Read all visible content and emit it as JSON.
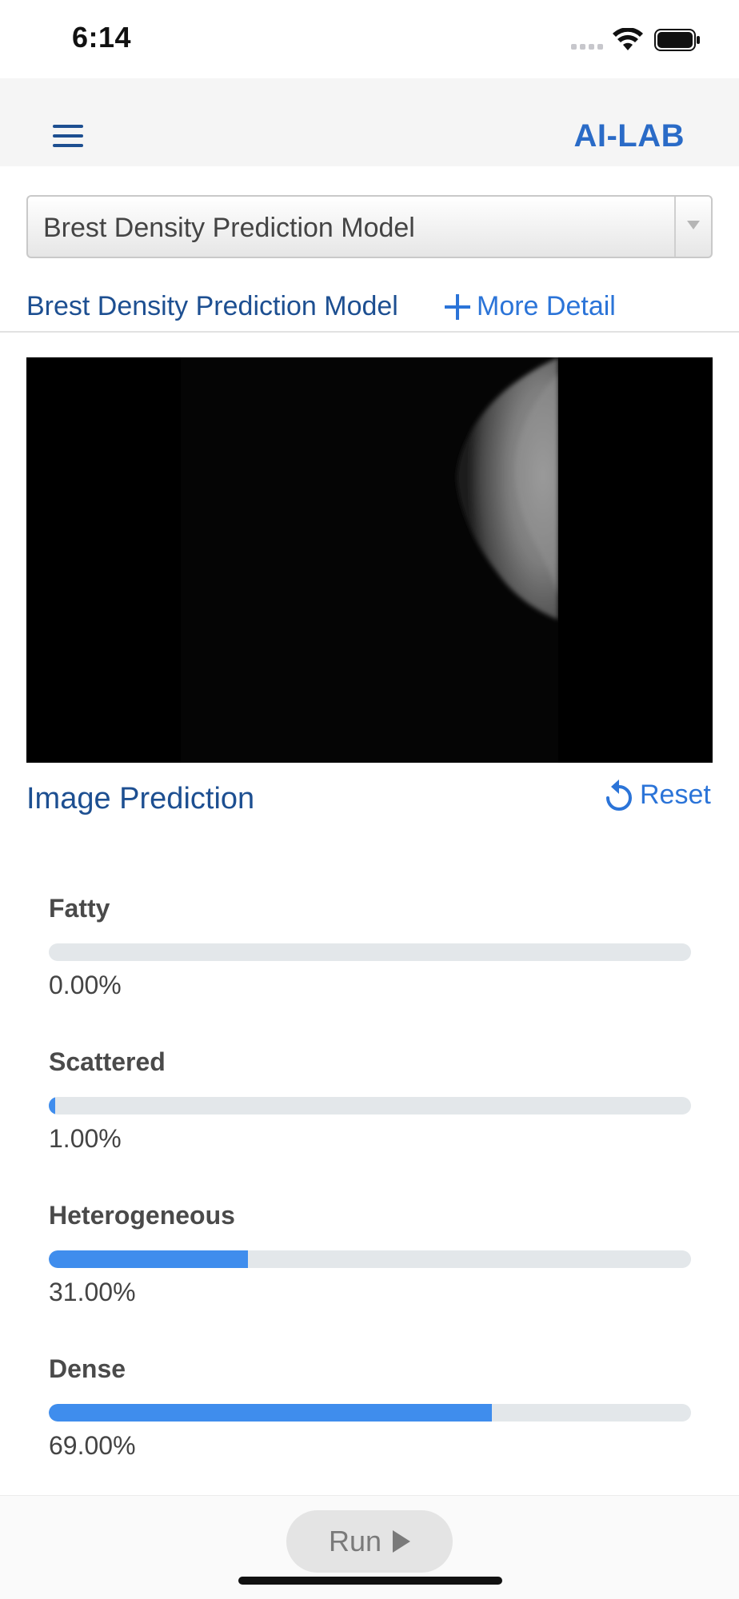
{
  "status_bar": {
    "time": "6:14"
  },
  "header": {
    "brand": "AI-LAB"
  },
  "model_select": {
    "selected": "Brest Density Prediction Model"
  },
  "model_info": {
    "name": "Brest Density Prediction Model",
    "more_detail_label": "More Detail"
  },
  "prediction": {
    "title": "Image Prediction",
    "reset_label": "Reset",
    "items": [
      {
        "label": "Fatty",
        "value_text": "0.00%",
        "percent": 0
      },
      {
        "label": "Scattered",
        "value_text": "1.00%",
        "percent": 1
      },
      {
        "label": "Heterogeneous",
        "value_text": "31.00%",
        "percent": 31
      },
      {
        "label": "Dense",
        "value_text": "69.00%",
        "percent": 69
      }
    ],
    "fill_color": "#3f8ded",
    "track_color": "#e3e7ea"
  },
  "footer": {
    "run_label": "Run"
  }
}
